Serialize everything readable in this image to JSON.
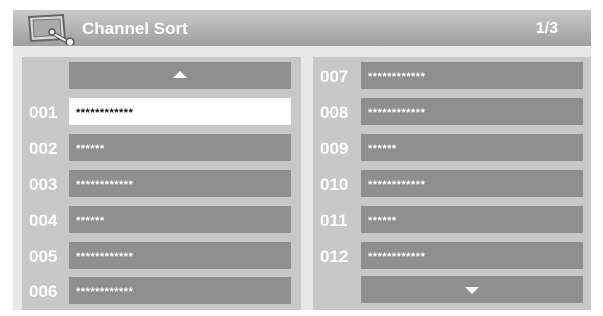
{
  "header": {
    "title": "Channel Sort",
    "page_indicator": "1/3",
    "icon": "settings-wrench-monitor-icon"
  },
  "navigation": {
    "up_icon": "arrow-up-icon",
    "down_icon": "arrow-down-icon"
  },
  "channels": [
    {
      "number": "001",
      "name": "************",
      "selected": true
    },
    {
      "number": "002",
      "name": "******",
      "selected": false
    },
    {
      "number": "003",
      "name": "************",
      "selected": false
    },
    {
      "number": "004",
      "name": "******",
      "selected": false
    },
    {
      "number": "005",
      "name": "************",
      "selected": false
    },
    {
      "number": "006",
      "name": "************",
      "selected": false
    },
    {
      "number": "007",
      "name": "************",
      "selected": false
    },
    {
      "number": "008",
      "name": "************",
      "selected": false
    },
    {
      "number": "009",
      "name": "******",
      "selected": false
    },
    {
      "number": "010",
      "name": "************",
      "selected": false
    },
    {
      "number": "011",
      "name": "******",
      "selected": false
    },
    {
      "number": "012",
      "name": "************",
      "selected": false
    }
  ],
  "colors": {
    "header_bg": "#b4b4b4",
    "panel_bg": "#c8c8c8",
    "item_bg": "#8f8f8f",
    "selected_bg": "#ffffff",
    "text": "#ffffff"
  }
}
